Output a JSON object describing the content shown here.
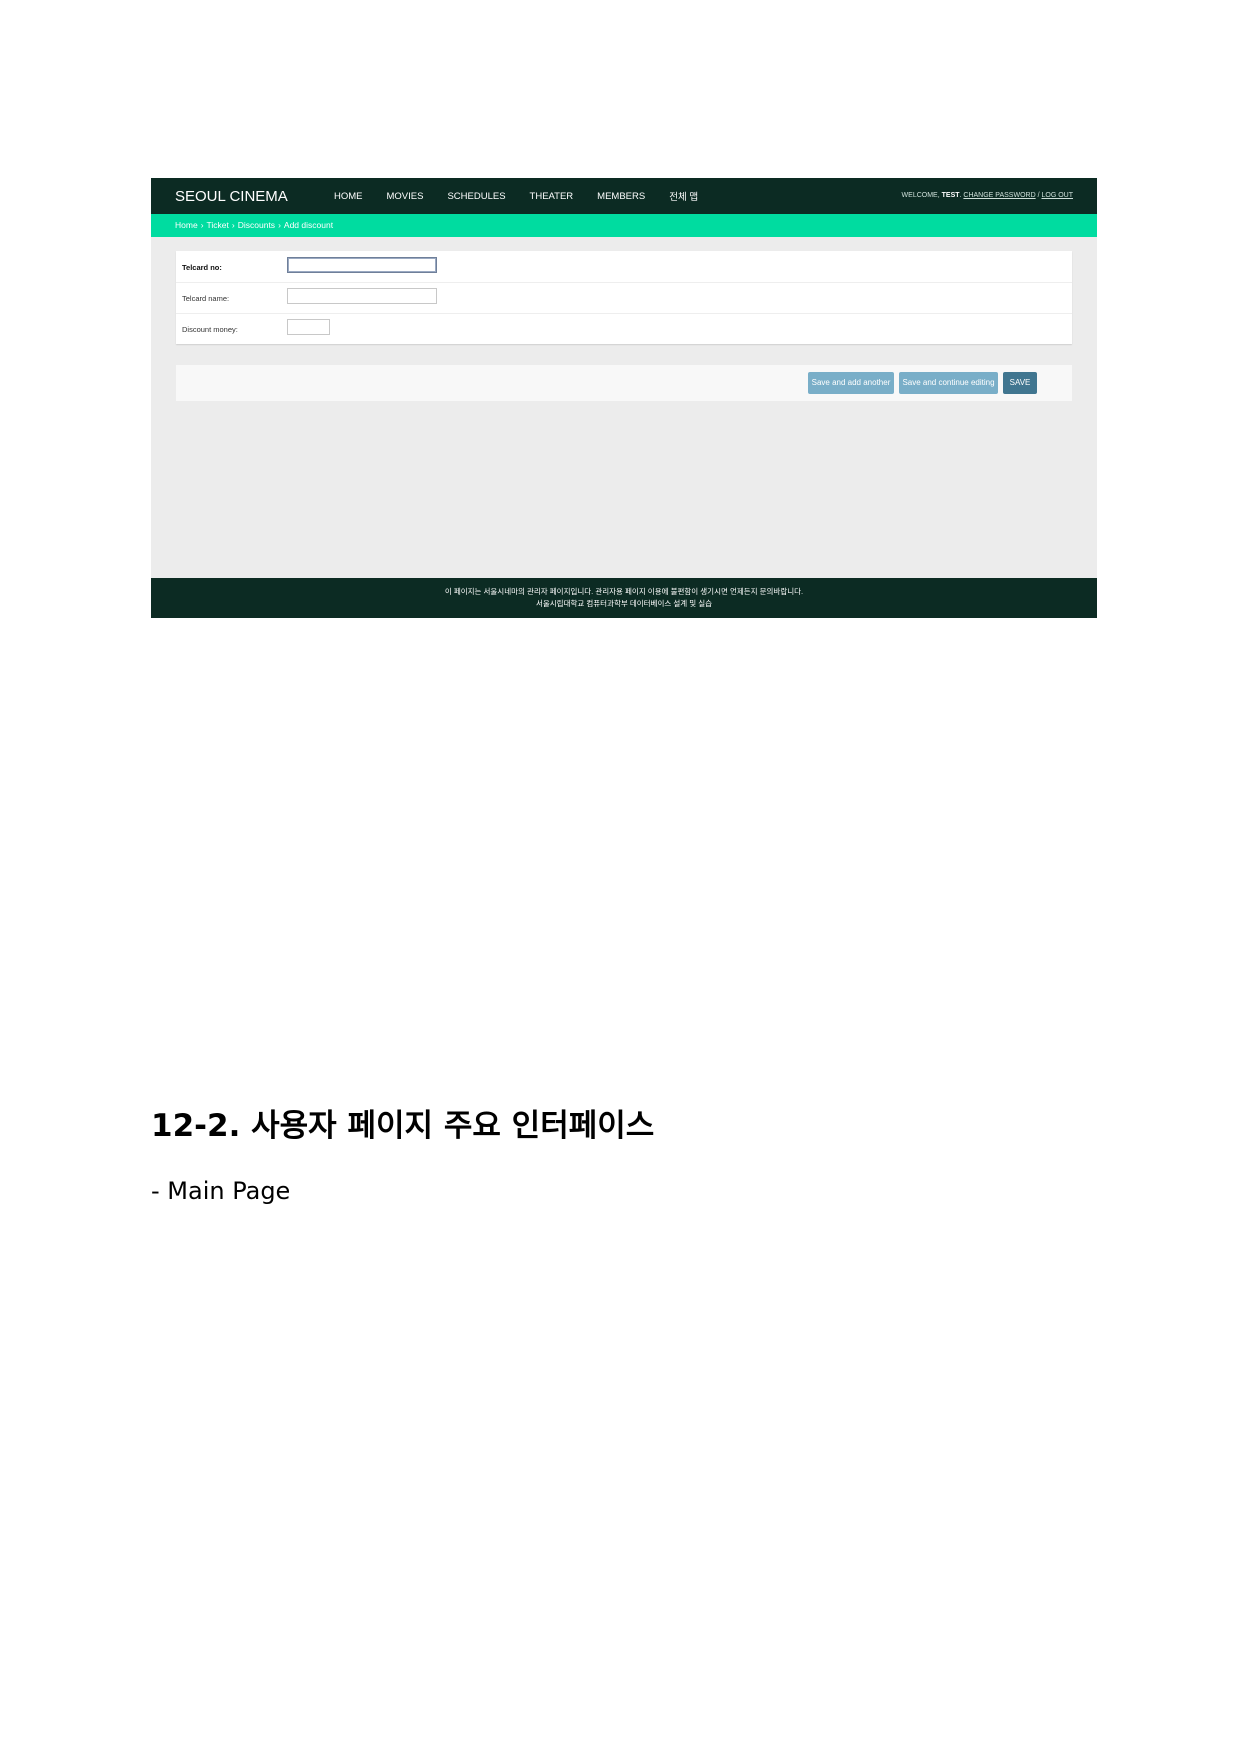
{
  "admin_screenshot": {
    "brand": "SEOUL CINEMA",
    "nav": [
      "HOME",
      "MOVIES",
      "SCHEDULES",
      "THEATER",
      "MEMBERS",
      "전체 맵"
    ],
    "user": {
      "welcome": "WELCOME,",
      "username": "TEST",
      "change_password": "CHANGE PASSWORD",
      "separator": "/",
      "logout": "LOG OUT"
    },
    "breadcrumbs": [
      "Home",
      "Ticket",
      "Discounts",
      "Add discount"
    ],
    "breadcrumb_separator": "›",
    "form": {
      "fields": [
        {
          "label": "Telcard no:",
          "value": "",
          "required": true,
          "focused": true
        },
        {
          "label": "Telcard name:",
          "value": "",
          "required": false,
          "focused": false
        },
        {
          "label": "Discount money:",
          "value": "",
          "required": false,
          "focused": false
        }
      ]
    },
    "buttons": {
      "save_add_another": "Save and add another",
      "save_continue": "Save and continue editing",
      "save": "SAVE"
    },
    "footer": {
      "line1": "이 페이지는 서울시네마의 관리자 페이지입니다. 관리자용 페이지 이용에 불편함이 생기시면 언제든지 문의바랍니다.",
      "line2": "서울시립대학교 컴퓨터과학부 데이터베이스 설계 및 실습"
    },
    "colors": {
      "topbar": "#0c2b23",
      "breadcrumb_bar": "#00dca0",
      "button_light": "#79aec8",
      "button_dark": "#417690"
    }
  },
  "document": {
    "heading": "12-2. 사용자 페이지 주요 인터페이스",
    "subheading": "- Main Page"
  }
}
